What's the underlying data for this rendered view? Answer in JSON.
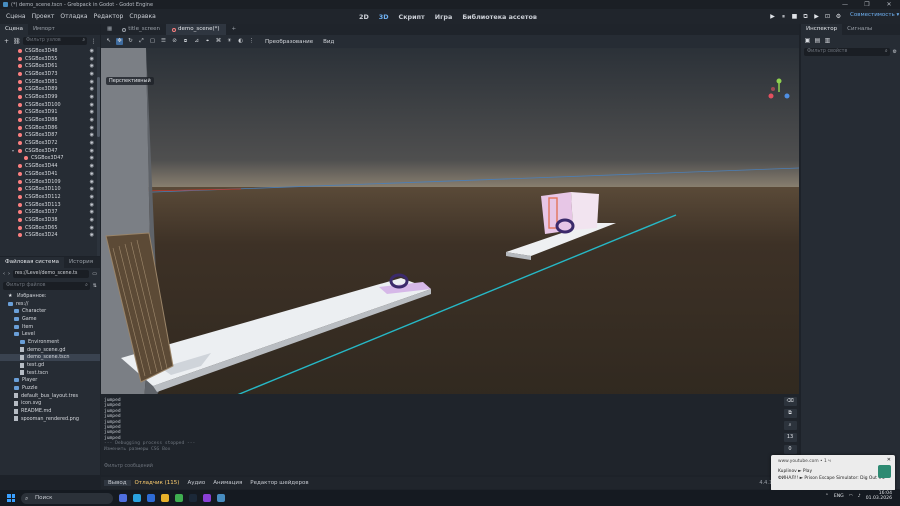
{
  "window": {
    "title": "(*) demo_scene.tscn - Grebpack in Godot - Godot Engine",
    "controls": [
      "—",
      "❐",
      "✕"
    ]
  },
  "menu": {
    "items": [
      "Сцена",
      "Проект",
      "Отладка",
      "Редактор",
      "Справка"
    ],
    "modes": [
      "2D",
      "3D",
      "Скрипт",
      "Игра",
      "Библиотека ассетов"
    ],
    "active_mode": "3D",
    "run_icons": [
      "▶",
      "⏸",
      "■",
      "⧉",
      "▶",
      "⊡",
      "⚙"
    ],
    "renderer": "Совместимость ▾"
  },
  "scene_panel": {
    "tabs": [
      "Сцена",
      "Импорт"
    ],
    "add_icon": "+",
    "link_icon": "🔗",
    "filter_placeholder": "Фильтр узлов",
    "nodes": [
      {
        "name": "CSGBox3D48",
        "indent": 1
      },
      {
        "name": "CSGBox3D55",
        "indent": 1
      },
      {
        "name": "CSGBox3D61",
        "indent": 1
      },
      {
        "name": "CSGBox3D73",
        "indent": 1
      },
      {
        "name": "CSGBox3D81",
        "indent": 1
      },
      {
        "name": "CSGBox3D89",
        "indent": 1
      },
      {
        "name": "CSGBox3D99",
        "indent": 1
      },
      {
        "name": "CSGBox3D100",
        "indent": 1
      },
      {
        "name": "CSGBox3D91",
        "indent": 1
      },
      {
        "name": "CSGBox3D88",
        "indent": 1
      },
      {
        "name": "CSGBox3D86",
        "indent": 1
      },
      {
        "name": "CSGBox3D87",
        "indent": 1
      },
      {
        "name": "CSGBox3D72",
        "indent": 1
      },
      {
        "name": "CSGBox3D47",
        "indent": 0,
        "expanded": true
      },
      {
        "name": "CSGBox3D47",
        "indent": 2
      },
      {
        "name": "CSGBox3D44",
        "indent": 1
      },
      {
        "name": "CSGBox3D41",
        "indent": 1
      },
      {
        "name": "CSGBox3D109",
        "indent": 1
      },
      {
        "name": "CSGBox3D110",
        "indent": 1
      },
      {
        "name": "CSGBox3D112",
        "indent": 1
      },
      {
        "name": "CSGBox3D113",
        "indent": 1
      },
      {
        "name": "CSGBox3D37",
        "indent": 1
      },
      {
        "name": "CSGBox3D38",
        "indent": 1
      },
      {
        "name": "CSGBox3D65",
        "indent": 1
      },
      {
        "name": "CSGBox3D24",
        "indent": 1
      }
    ]
  },
  "fs_panel": {
    "tabs": [
      "Файловая система",
      "История"
    ],
    "path": "res://Level/demo_scene.ts",
    "filter_placeholder": "Фильтр файлов",
    "favorites_label": "Избранное:",
    "items": [
      {
        "name": "res://",
        "type": "folder",
        "indent": 0
      },
      {
        "name": "Character",
        "type": "folder",
        "indent": 1
      },
      {
        "name": "Game",
        "type": "folder",
        "indent": 1
      },
      {
        "name": "Item",
        "type": "folder",
        "indent": 1
      },
      {
        "name": "Level",
        "type": "folder",
        "indent": 1
      },
      {
        "name": "Environment",
        "type": "folder",
        "indent": 2
      },
      {
        "name": "demo_scene.gd",
        "type": "file",
        "indent": 2
      },
      {
        "name": "demo_scene.tscn",
        "type": "file",
        "indent": 2,
        "selected": true
      },
      {
        "name": "test.gd",
        "type": "file",
        "indent": 2
      },
      {
        "name": "test.tscn",
        "type": "file",
        "indent": 2
      },
      {
        "name": "Player",
        "type": "folder",
        "indent": 1
      },
      {
        "name": "Puzzle",
        "type": "folder",
        "indent": 1
      },
      {
        "name": "default_bus_layout.tres",
        "type": "file",
        "indent": 1
      },
      {
        "name": "icon.svg",
        "type": "file",
        "indent": 1
      },
      {
        "name": "README.md",
        "type": "file",
        "indent": 1
      },
      {
        "name": "spooman_rendered.png",
        "type": "file",
        "indent": 1
      }
    ]
  },
  "doc_tabs": {
    "items": [
      "title_screen",
      "demo_scene(*)"
    ],
    "active": 1,
    "add": "+"
  },
  "viewport_toolbar": {
    "transform_menu": "Преобразование",
    "view_menu": "Вид",
    "perspective_label": "Перспективный"
  },
  "output": {
    "lines": [
      "jumped",
      "jumped",
      "jumped",
      "jumped",
      "jumped",
      "jumped",
      "jumped",
      "jumped"
    ],
    "dim_lines": [
      "--- Debugging process stopped ---",
      "Изменить размеры CSG Box"
    ],
    "filter_placeholder": "Фильтр сообщений",
    "count_errors": "13",
    "count_warn": "0"
  },
  "bottom_tabs": {
    "items": [
      "Вывод",
      "Отладчик (115)",
      "Аудио",
      "Анимация",
      "Редактор шейдеров"
    ],
    "active": 0,
    "version": "4.4.1.stable"
  },
  "inspector": {
    "tabs": [
      "Инспектор",
      "Сигналы"
    ],
    "filter_placeholder": "Фильтр свойств"
  },
  "notification": {
    "source": "www.youtube.com • 1 ч",
    "line1": "Kuplinov ► Play",
    "line2": "ФИНАЛ!! ► Prison Escape Simulator: Dig Out #5",
    "close": "✕"
  },
  "taskbar": {
    "search_placeholder": "Поиск",
    "lang": "ENG",
    "time": "16:04",
    "date": "01.03.2026"
  },
  "colors": {
    "accent": "#6fb1f2",
    "node_icon": "#fc7f7f",
    "folder": "#6a9fd8",
    "warn": "#ffcf6f"
  }
}
